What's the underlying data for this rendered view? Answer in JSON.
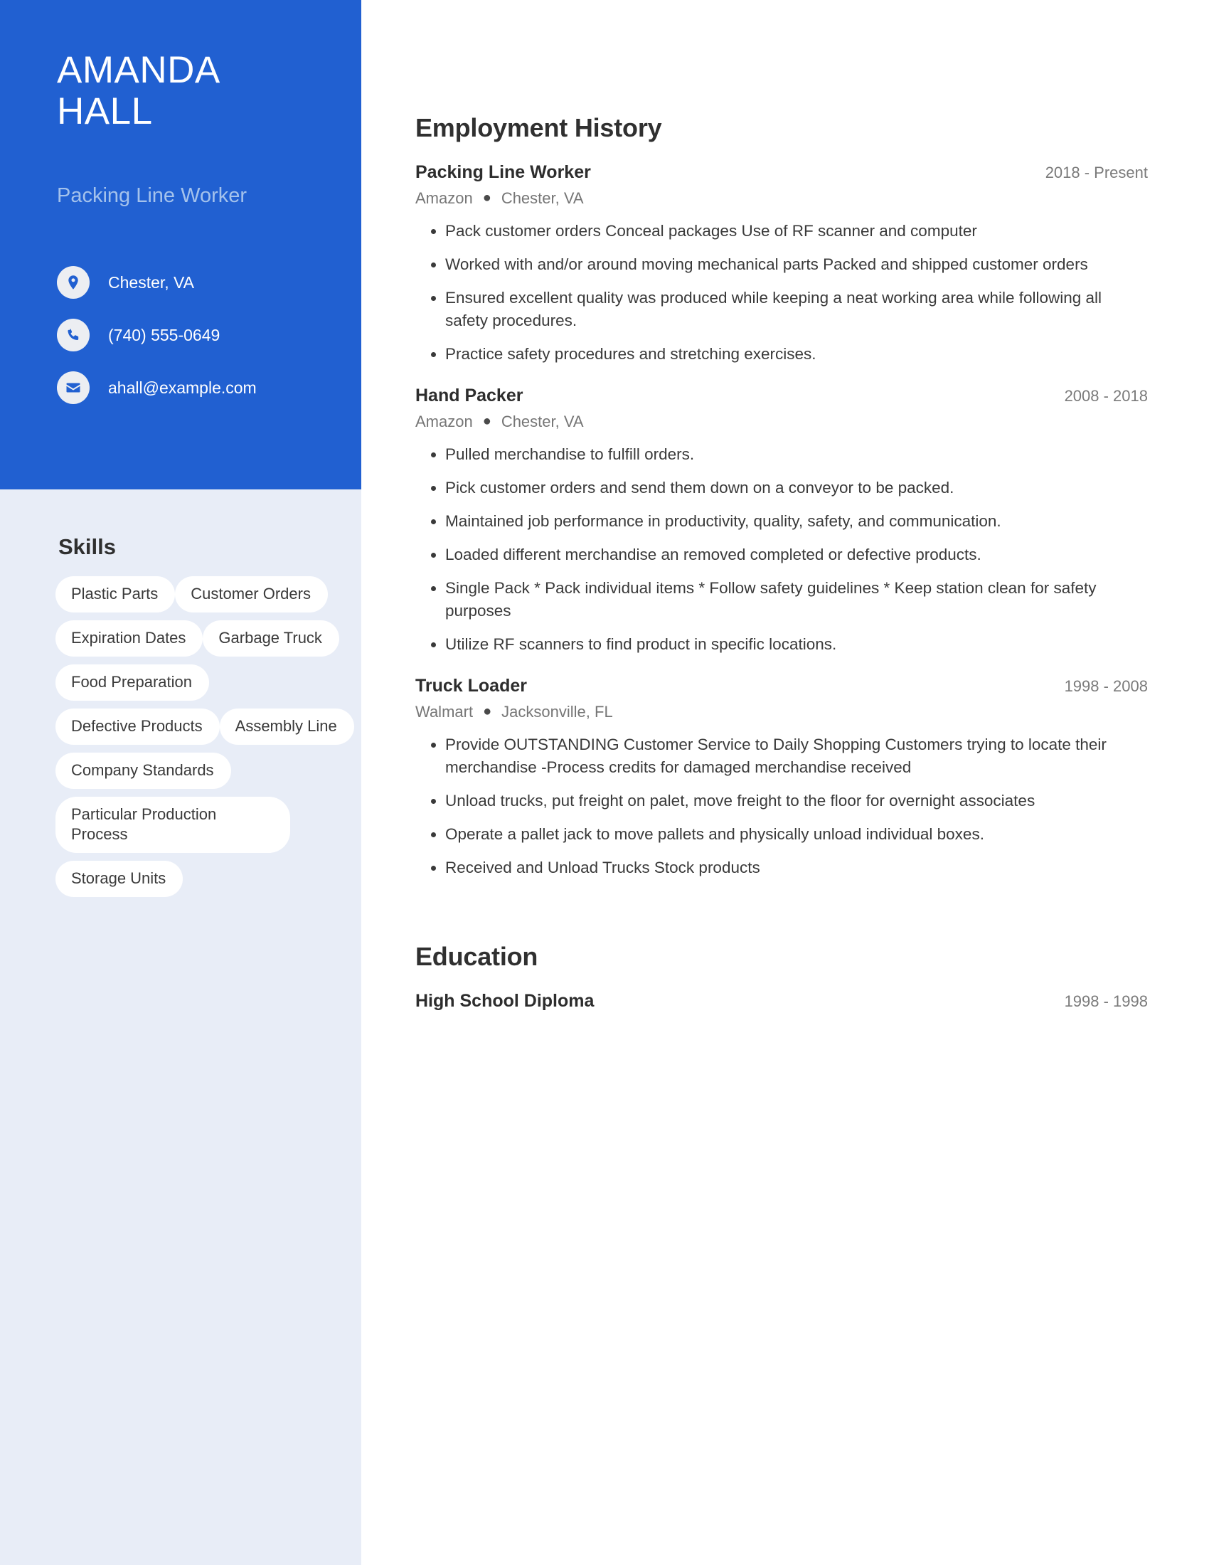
{
  "theme": {
    "accent_blue": "#2160d1",
    "sidebar_light": "#e8edf7",
    "subtitle_blue": "#a4c2ec",
    "pill_white": "#ffffff",
    "text_dark": "#333333",
    "text_muted": "#767676"
  },
  "profile": {
    "first_name": "AMANDA",
    "last_name": "HALL",
    "job_title": "Packing Line Worker"
  },
  "contact": {
    "items": [
      {
        "icon": "location-pin-icon",
        "value": "Chester, VA"
      },
      {
        "icon": "phone-icon",
        "value": "(740) 555-0649"
      },
      {
        "icon": "envelope-icon",
        "value": "ahall@example.com"
      }
    ]
  },
  "skills": {
    "title": "Skills",
    "items": [
      "Plastic Parts",
      "Customer Orders",
      "Expiration Dates",
      "Garbage Truck",
      "Food Preparation",
      "Defective Products",
      "Assembly Line",
      "Company Standards",
      "Particular Production Process",
      "Storage Units"
    ]
  },
  "employment": {
    "title": "Employment History",
    "entries": [
      {
        "role": "Packing Line Worker",
        "dates": "2018 - Present",
        "company": "Amazon",
        "location": "Chester, VA",
        "bullets": [
          "Pack customer orders Conceal packages Use of RF scanner and computer",
          "Worked with and/or around moving mechanical parts Packed and shipped customer orders",
          "Ensured excellent quality was produced while keeping a neat working area while following all safety procedures.",
          "Practice safety procedures and stretching exercises."
        ]
      },
      {
        "role": "Hand Packer",
        "dates": "2008 - 2018",
        "company": "Amazon",
        "location": "Chester, VA",
        "bullets": [
          "Pulled merchandise to fulfill orders.",
          "Pick customer orders and send them down on a conveyor to be packed.",
          "Maintained job performance in productivity, quality, safety, and communication.",
          "Loaded different merchandise an removed completed or defective products.",
          "Single Pack * Pack individual items * Follow safety guidelines * Keep station clean for safety purposes",
          "Utilize RF scanners to find product in specific locations."
        ]
      },
      {
        "role": "Truck Loader",
        "dates": "1998 - 2008",
        "company": "Walmart",
        "location": "Jacksonville, FL",
        "bullets": [
          "Provide OUTSTANDING Customer Service to Daily Shopping Customers trying to locate their merchandise -Process credits for damaged merchandise received",
          "Unload trucks, put freight on palet, move freight to the floor for overnight associates",
          "Operate a pallet jack to move pallets and physically unload individual boxes.",
          "Received and Unload Trucks Stock products"
        ]
      }
    ]
  },
  "education": {
    "title": "Education",
    "entries": [
      {
        "degree": "High School Diploma",
        "dates": "1998 - 1998"
      }
    ]
  },
  "separator_glyph": "●"
}
